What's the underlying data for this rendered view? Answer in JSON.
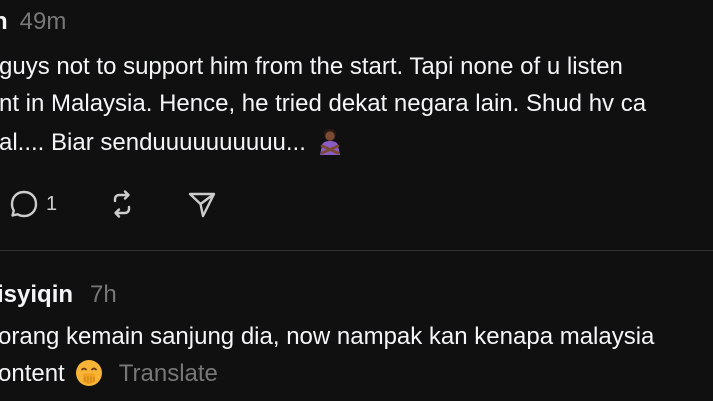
{
  "post1": {
    "username": "h",
    "time": "49m",
    "lines": [
      "guys not to support him from the start. Tapi none of u listen",
      "nt in Malaysia. Hence, he tried dekat negara lain. Shud hv ca",
      "al.... Biar senduuuuuuuuuu..."
    ],
    "emoji_icon": "person-gesturing-no-icon",
    "actions": {
      "reply_icon": "comment-icon",
      "reply_count": "1",
      "repost_icon": "repost-icon",
      "share_icon": "send-icon"
    }
  },
  "post2": {
    "username": "isyiqin",
    "time": "7h",
    "lines": [
      "orang kemain sanjung dia, now nampak kan kenapa malaysia",
      "ontent"
    ],
    "emoji_icon": "face-with-hand-over-mouth-icon",
    "translate_label": "Translate"
  },
  "colors": {
    "background": "#101010",
    "text_primary": "#f3f5f7",
    "text_secondary": "#777777",
    "divider": "#323232"
  }
}
